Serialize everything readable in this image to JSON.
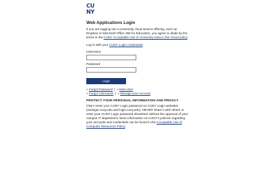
{
  "brand": {
    "logo_top": "CU",
    "logo_bottom": "NY"
  },
  "page": {
    "title": "Web Applications Login",
    "intro": "If you are logging into a University cloud service offering, such as Dropbox or Microsoft Office 365 for Education, you agree to abide by the terms in the ",
    "intro_link": "CUNY Acceptable Use of University Data in the Cloud policy",
    "intro_end": "."
  },
  "login": {
    "prompt": "Log in with your ",
    "prompt_link": "CUNY Login credentials",
    "prompt_end": ":",
    "username_label": "Username",
    "password_label": "Password",
    "username_value": "",
    "password_value": "",
    "button_label": "Login"
  },
  "links": {
    "prefix": "»",
    "forgot_password": "Forgot Password",
    "new_user": "New User",
    "forgot_username": "Forgot Username",
    "manage_account": "Manage your Account",
    "separator": "|"
  },
  "protect": {
    "heading": "PROTECT YOUR PERSONAL INFORMATION AND PRIVACY",
    "body": "ONLY enter your CUNY Login password on CUNY Login websites (ssologin.cuny.edu and login.cuny.edu). NEVER share it with others or enter your CUNY Login password elsewhere without the approval of your campus IT department. More information on CUNY's policies regarding your accounts and credentials can be found in the ",
    "link": "Acceptable Use of Computer Resources Policy",
    "end": "."
  }
}
